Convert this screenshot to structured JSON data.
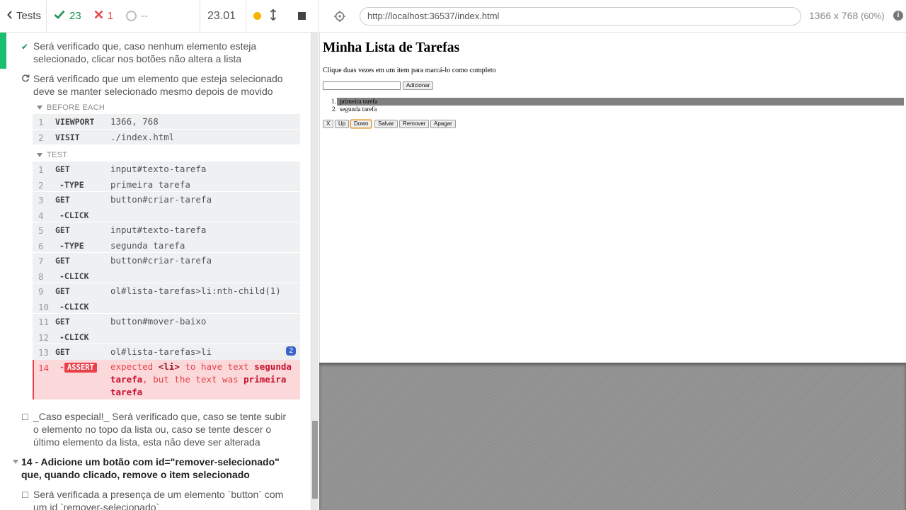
{
  "reporter": {
    "back_label": "Tests",
    "passed": "23",
    "failed": "1",
    "pending": "--",
    "duration": "23.01"
  },
  "command_log": {
    "tests": [
      {
        "status": "passed",
        "text": "Será verificado que, caso nenhum elemento esteja selecionado, clicar nos botões não altera a lista"
      },
      {
        "status": "running",
        "text": "Será verificado que um elemento que esteja selecionado deve se manter selecionado mesmo depois de movido"
      }
    ],
    "before_each": {
      "title": "BEFORE EACH",
      "commands": [
        {
          "num": "1",
          "name": "VIEWPORT",
          "message": "1366, 768"
        },
        {
          "num": "2",
          "name": "VISIT",
          "message": "./index.html"
        }
      ]
    },
    "test": {
      "title": "TEST",
      "commands": [
        {
          "num": "1",
          "name": "GET",
          "message": "input#texto-tarefa"
        },
        {
          "num": "2",
          "name": "-TYPE",
          "message": "primeira tarefa"
        },
        {
          "num": "3",
          "name": "GET",
          "message": "button#criar-tarefa"
        },
        {
          "num": "4",
          "name": "-CLICK",
          "message": ""
        },
        {
          "num": "5",
          "name": "GET",
          "message": "input#texto-tarefa"
        },
        {
          "num": "6",
          "name": "-TYPE",
          "message": "segunda tarefa"
        },
        {
          "num": "7",
          "name": "GET",
          "message": "button#criar-tarefa"
        },
        {
          "num": "8",
          "name": "-CLICK",
          "message": ""
        },
        {
          "num": "9",
          "name": "GET",
          "message": "ol#lista-tarefas>li:nth-child(1)"
        },
        {
          "num": "10",
          "name": "-CLICK",
          "message": ""
        },
        {
          "num": "11",
          "name": "GET",
          "message": "button#mover-baixo"
        },
        {
          "num": "12",
          "name": "-CLICK",
          "message": ""
        },
        {
          "num": "13",
          "name": "GET",
          "message": "ol#lista-tarefas>li",
          "badge": "2"
        }
      ],
      "assert": {
        "num": "14",
        "dash": "-",
        "name": "ASSERT",
        "expected": "expected",
        "subject": "<li>",
        "to_have": "to have text",
        "expected_text": "segunda tarefa",
        "but": ", but the text was",
        "actual_text": "primeira tarefa"
      }
    },
    "pending_test": "_Caso especial!_ Será verificado que, caso se tente subir o elemento no topo da lista ou, caso se tente descer o último elemento da lista, esta não deve ser alterada",
    "suite_title": "14 - Adicione um botão com id=\"remover-selecionado\" que, quando clicado, remove o item selecionado",
    "next_test": "Será verificada a presença de um elemento `button` com um id `remover-selecionado`"
  },
  "aut": {
    "url": "http://localhost:36537/index.html",
    "viewport": "1366 x 768",
    "scale": "(60%)",
    "page": {
      "title": "Minha Lista de Tarefas",
      "instructions": "Clique duas vezes em um item para marcá-lo como completo",
      "add_button": "Adicionar",
      "list_items": [
        "primeira tarefa",
        "segunda tarefa"
      ],
      "buttons": [
        "X",
        "Up",
        "Down",
        "Salvar",
        "Remover",
        "Apagar"
      ]
    }
  },
  "colors": {
    "passed": "#1d8f54",
    "failed": "#e8414a",
    "selected_item": "#808080",
    "badge": "#3b64c8"
  }
}
